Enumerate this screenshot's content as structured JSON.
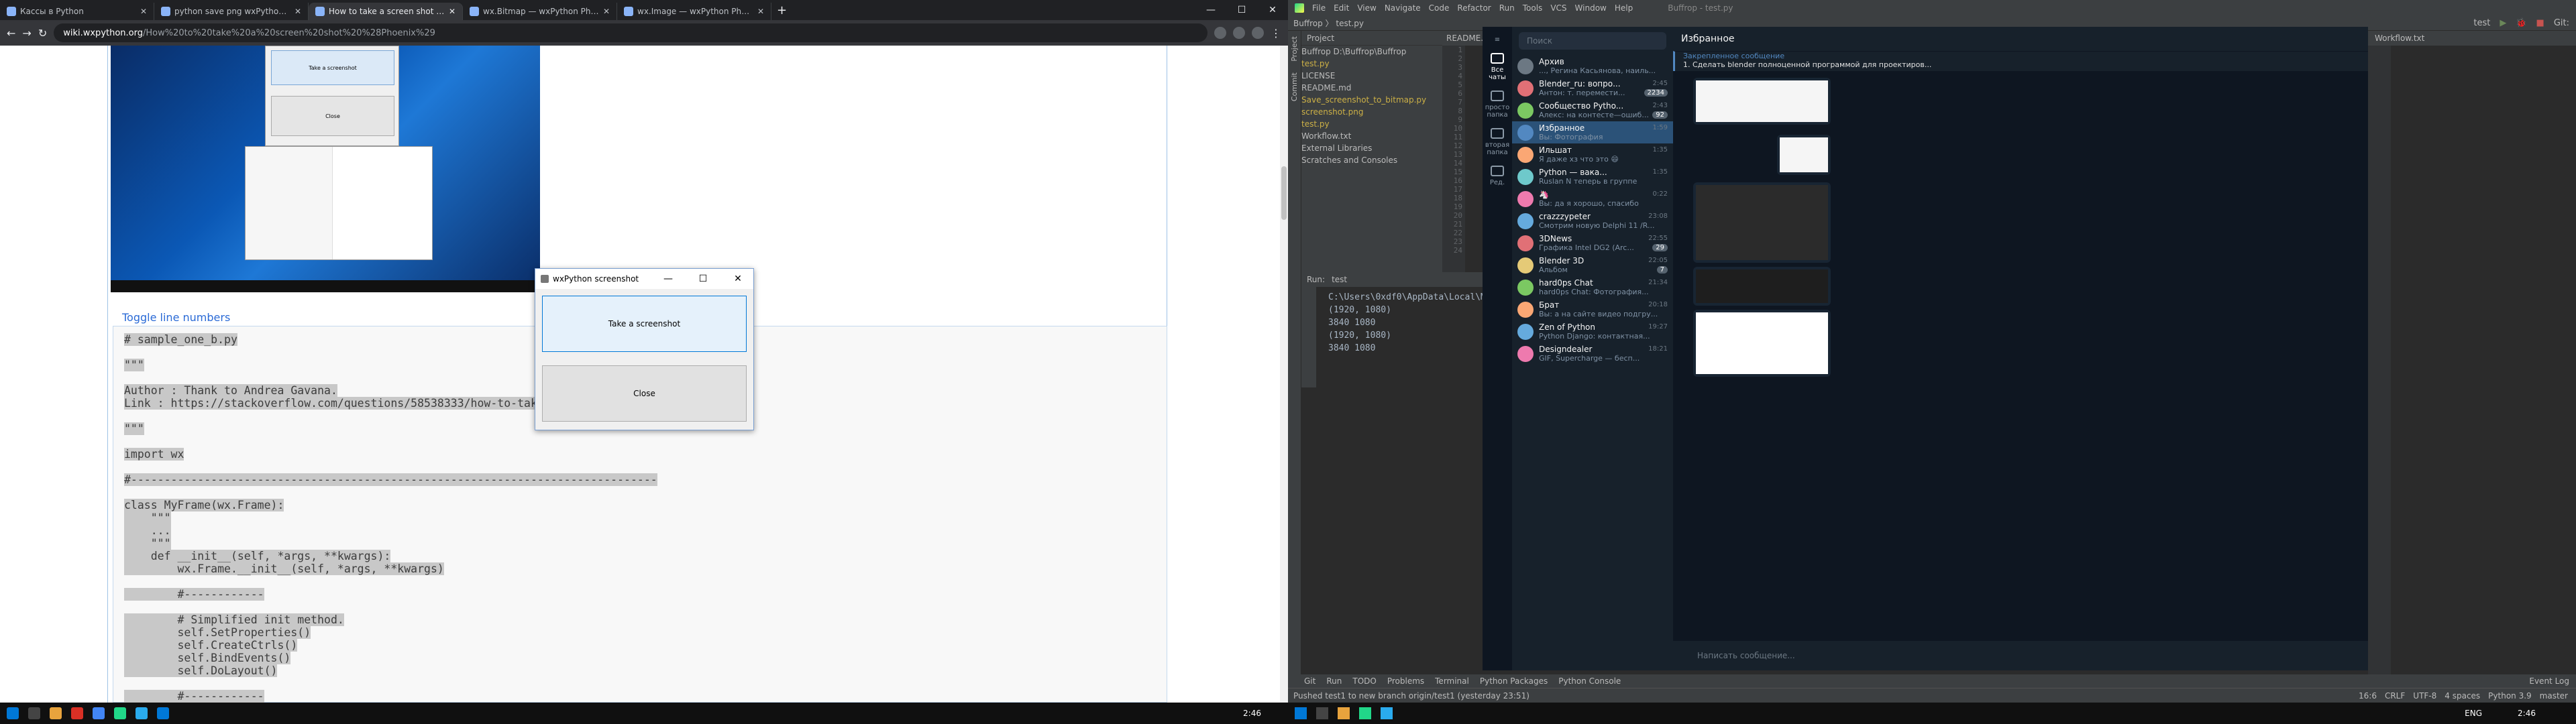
{
  "browser": {
    "tabs": [
      {
        "label": "Кассы в Python",
        "active": false
      },
      {
        "label": "python save png wxPython stac...",
        "active": false
      },
      {
        "label": "How to take a screen shot [Pyth...",
        "active": true
      },
      {
        "label": "wx.Bitmap — wxPython Phoenix...",
        "active": false
      },
      {
        "label": "wx.Image — wxPython Phoenix...",
        "active": false
      }
    ],
    "new_tab": "+",
    "url_host": "wiki.wxpython.org",
    "url_path": "/How%20to%20take%20a%20screen%20shot%20%28Phoenix%29"
  },
  "page": {
    "toggle": "Toggle line numbers",
    "code_lines": [
      "# sample_one_b.py",
      "",
      "\"\"\"",
      "",
      "Author : Thank to Andrea Gavana.",
      "Link : https://stackoverflow.com/questions/58538333/how-to-take-a-screenshot-using-wxpython",
      "",
      "\"\"\"",
      "",
      "import wx",
      "",
      "#-------------------------------------------------------------------------------",
      "",
      "class MyFrame(wx.Frame):",
      "    \"\"\"",
      "    ...",
      "    \"\"\"",
      "    def __init__(self, *args, **kwargs):",
      "        wx.Frame.__init__(self, *args, **kwargs)",
      "",
      "        #------------",
      "",
      "        # Simplified init method.",
      "        self.SetProperties()",
      "        self.CreateCtrls()",
      "        self.BindEvents()",
      "        self.DoLayout()",
      "",
      "        #------------"
    ],
    "shot_btn_take": "Take a screenshot",
    "shot_btn_close": "Close"
  },
  "dialog": {
    "title": "wxPython screenshot",
    "take": "Take a screenshot",
    "close": "Close",
    "min": "—",
    "max": "☐",
    "x": "✕"
  },
  "left_taskbar": {
    "clock": "2:46"
  },
  "ide": {
    "menu": [
      "File",
      "Edit",
      "View",
      "Navigate",
      "Code",
      "Refactor",
      "Run",
      "Tools",
      "VCS",
      "Window",
      "Help"
    ],
    "title": "Buffrop - test.py",
    "nav": "Buffrop  〉 test.py",
    "run_config": "test",
    "project_header": "Project",
    "tree": [
      {
        "label": "Buffrop  D:\\Buffrop\\Buffrop",
        "cls": ""
      },
      {
        "label": "    test.py",
        "cls": "y"
      },
      {
        "label": "    LICENSE",
        "cls": ""
      },
      {
        "label": "    README.md",
        "cls": ""
      },
      {
        "label": "    Save_screenshot_to_bitmap.py",
        "cls": "y"
      },
      {
        "label": "    screenshot.png",
        "cls": "y"
      },
      {
        "label": "    test.py",
        "cls": "y"
      },
      {
        "label": "    Workflow.txt",
        "cls": ""
      },
      {
        "label": "  External Libraries",
        "cls": ""
      },
      {
        "label": "  Scratches and Consoles",
        "cls": ""
      }
    ],
    "editor_tab": "README.md",
    "right_tab": "Workflow.txt",
    "run_header": "Run:",
    "run_tab": "test",
    "run_output": [
      "C:\\Users\\0xdf0\\AppData\\Local\\Microsoft\\WindowsApps\\p",
      "(1920, 1080)",
      "3840 1080",
      "(1920, 1080)",
      "3840 1080"
    ],
    "bottom_tabs": [
      "Git",
      "Run",
      "TODO",
      "Problems",
      "Terminal",
      "Python Packages",
      "Python Console"
    ],
    "event_log": "Event Log",
    "status_msg": "Pushed test1 to new branch origin/test1 (yesterday 23:51)",
    "status_right": [
      "16:6",
      "CRLF",
      "UTF-8",
      "4 spaces",
      "Python 3.9",
      "master"
    ],
    "clock": "2:46",
    "lang": "ENG"
  },
  "telegram": {
    "search": "Поиск",
    "folders": [
      {
        "label": "Все чаты",
        "active": true
      },
      {
        "label": "просто папка",
        "active": false
      },
      {
        "label": "вторая папка",
        "active": false
      },
      {
        "label": "Ред.",
        "active": false
      }
    ],
    "chats": [
      {
        "name": "Архив",
        "msg": "..., Регина Касьянова, наиль...",
        "time": "",
        "badge": "",
        "color": "#6c7883"
      },
      {
        "name": "Blender_ru: вопро...",
        "msg": "Антон: т. перемести...",
        "time": "2:45",
        "badge": "2234",
        "color": "#e17076"
      },
      {
        "name": "Сообщество Pytho...",
        "msg": "Алекс: на контесте—ошиб...",
        "time": "2:43",
        "badge": "92",
        "color": "#7bc862"
      },
      {
        "name": "Избранное",
        "msg": "Вы: Фотография",
        "time": "1:59",
        "badge": "",
        "color": "#5288c1"
      },
      {
        "name": "Ильшат",
        "msg": "Я даже хз что это 😄",
        "time": "1:35",
        "badge": "",
        "color": "#faa774"
      },
      {
        "name": "Python — вакa...",
        "msg": "Ruslan N теперь в группе",
        "time": "1:35",
        "badge": "",
        "color": "#6ec9cb"
      },
      {
        "name": "🦄",
        "msg": "Вы: да я хорошо, спасибо",
        "time": "0:22",
        "badge": "",
        "color": "#ee7aae"
      },
      {
        "name": "crazzzypeter",
        "msg": "Смотрим новую Delphi 11 /R...",
        "time": "23:08",
        "badge": "",
        "color": "#65aadd"
      },
      {
        "name": "3DNews",
        "msg": "Графика Intel DG2 (Arc...",
        "time": "22:55",
        "badge": "29",
        "color": "#e17076"
      },
      {
        "name": "Blender 3D",
        "msg": "Альбом",
        "time": "22:05",
        "badge": "7",
        "color": "#e5ca77"
      },
      {
        "name": "hard0ps Chat",
        "msg": "hard0ps Chat: Фотография...",
        "time": "21:34",
        "badge": "",
        "color": "#7bc862"
      },
      {
        "name": "Брат",
        "msg": "Вы: а на сайте видео подгру...",
        "time": "20:18",
        "badge": "",
        "color": "#faa774"
      },
      {
        "name": "Zen of Python",
        "msg": "Python Django: контактная...",
        "time": "19:27",
        "badge": "",
        "color": "#65aadd"
      },
      {
        "name": "Designdealer",
        "msg": "GIF, Supercharge — бесп...",
        "time": "18:21",
        "badge": "",
        "color": "#ee7aae"
      }
    ],
    "header": "Избранное",
    "pinned_label": "Закрепленное сообщение",
    "pinned_text": "1. Сделать blender полноценной программой для проектиров...",
    "input": "Написать сообщение..."
  }
}
